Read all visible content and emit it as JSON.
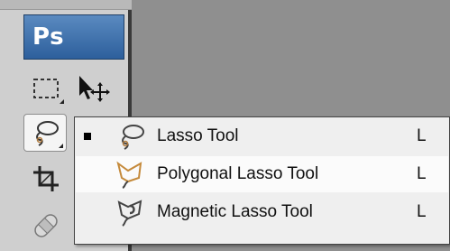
{
  "toolbar": {
    "logo": "Ps",
    "tools": [
      {
        "name": "rectangular-marquee",
        "icon": "marquee-icon"
      },
      {
        "name": "move",
        "icon": "move-icon"
      },
      {
        "name": "lasso",
        "icon": "lasso-icon",
        "active": true
      },
      {
        "name": "crop",
        "icon": "crop-icon"
      },
      {
        "name": "healing",
        "icon": "bandage-icon"
      }
    ]
  },
  "flyout": {
    "items": [
      {
        "label": "Lasso Tool",
        "shortcut": "L",
        "selected": true,
        "icon": "lasso-icon"
      },
      {
        "label": "Polygonal Lasso Tool",
        "shortcut": "L",
        "selected": false,
        "hover": true,
        "icon": "polygonal-lasso-icon"
      },
      {
        "label": "Magnetic Lasso Tool",
        "shortcut": "L",
        "selected": false,
        "icon": "magnetic-lasso-icon"
      }
    ]
  },
  "colors": {
    "canvas": "#8f8f8f",
    "toolbar": "#cfcfcf",
    "logo": "#2d5f9c",
    "menu": "#efefef"
  }
}
